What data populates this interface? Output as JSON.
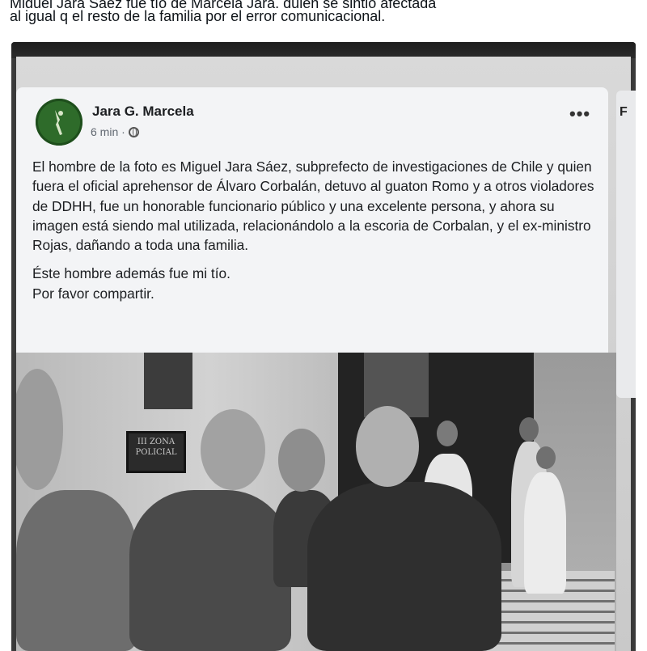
{
  "tweet": {
    "line1": "Miguel Jara Sáez fue tío de Marcela Jara, quien se sintió afectada",
    "line2": "al igual q el resto de la familia por el error comunicacional."
  },
  "post": {
    "author": "Jara G. Marcela",
    "time": "6 min ·",
    "more": "•••",
    "paragraph1": "El hombre de la foto es Miguel Jara Sáez, subprefecto de investigaciones de Chile y quien fuera el oficial aprehensor de Álvaro Corbalán, detuvo al guaton Romo y a otros violadores de DDHH, fue un honorable funcionario público y una excelente persona, y ahora su imagen está siendo mal utilizada, relacionándolo a la escoria de Corbalan, y el ex-ministro Rojas, dañando a toda una familia.",
    "line_a": "Éste hombre además fue mi tío.",
    "line_b": "Por favor compartir."
  },
  "photo": {
    "sign_text": "III ZONA POLICIAL"
  },
  "right_card": {
    "letter": "F"
  },
  "icons": [
    "avatar-logo-icon",
    "globe-icon",
    "more-options-icon"
  ]
}
